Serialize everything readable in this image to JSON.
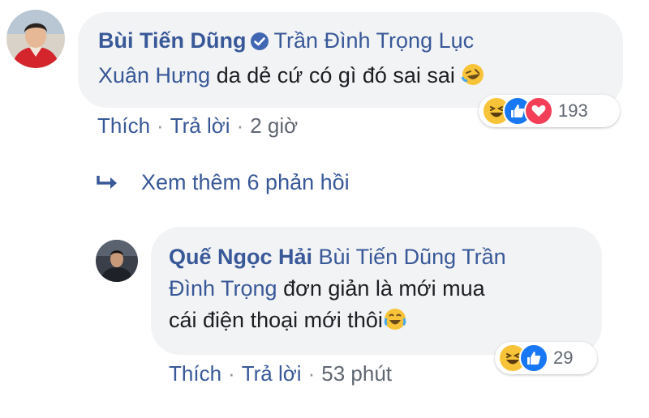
{
  "comment": {
    "author": "Bùi Tiến Dũng",
    "tag_line1": "Trần Đình Trọng Lục",
    "tag_line2": "Xuân Hưng",
    "text": "da dẻ cứ có gì đó sai sai",
    "emoji": "🤣",
    "actions": {
      "like": "Thích",
      "reply": "Trả lời",
      "time": "2 giờ"
    },
    "reaction_count": "193",
    "reaction_icons": [
      "haha-icon",
      "like-icon",
      "love-icon"
    ]
  },
  "view_more": {
    "label": "Xem thêm 6 phản hồi"
  },
  "reply": {
    "author": "Quế Ngọc Hải",
    "tag_part1": "Bùi Tiến Dũng Trần",
    "tag_part2": "Đình Trọng",
    "text_line2": "đơn giản là mới mua",
    "text_line3": "cái điện thoại mới thôi",
    "emoji": "😂",
    "actions": {
      "like": "Thích",
      "reply": "Trả lời",
      "time": "53 phút"
    },
    "reaction_count": "29",
    "reaction_icons": [
      "haha-icon",
      "like-icon"
    ]
  },
  "colors": {
    "link": "#385898",
    "bubble": "#f2f3f5",
    "meta": "#606770",
    "like": "#1877f2",
    "love": "#f33e58"
  }
}
